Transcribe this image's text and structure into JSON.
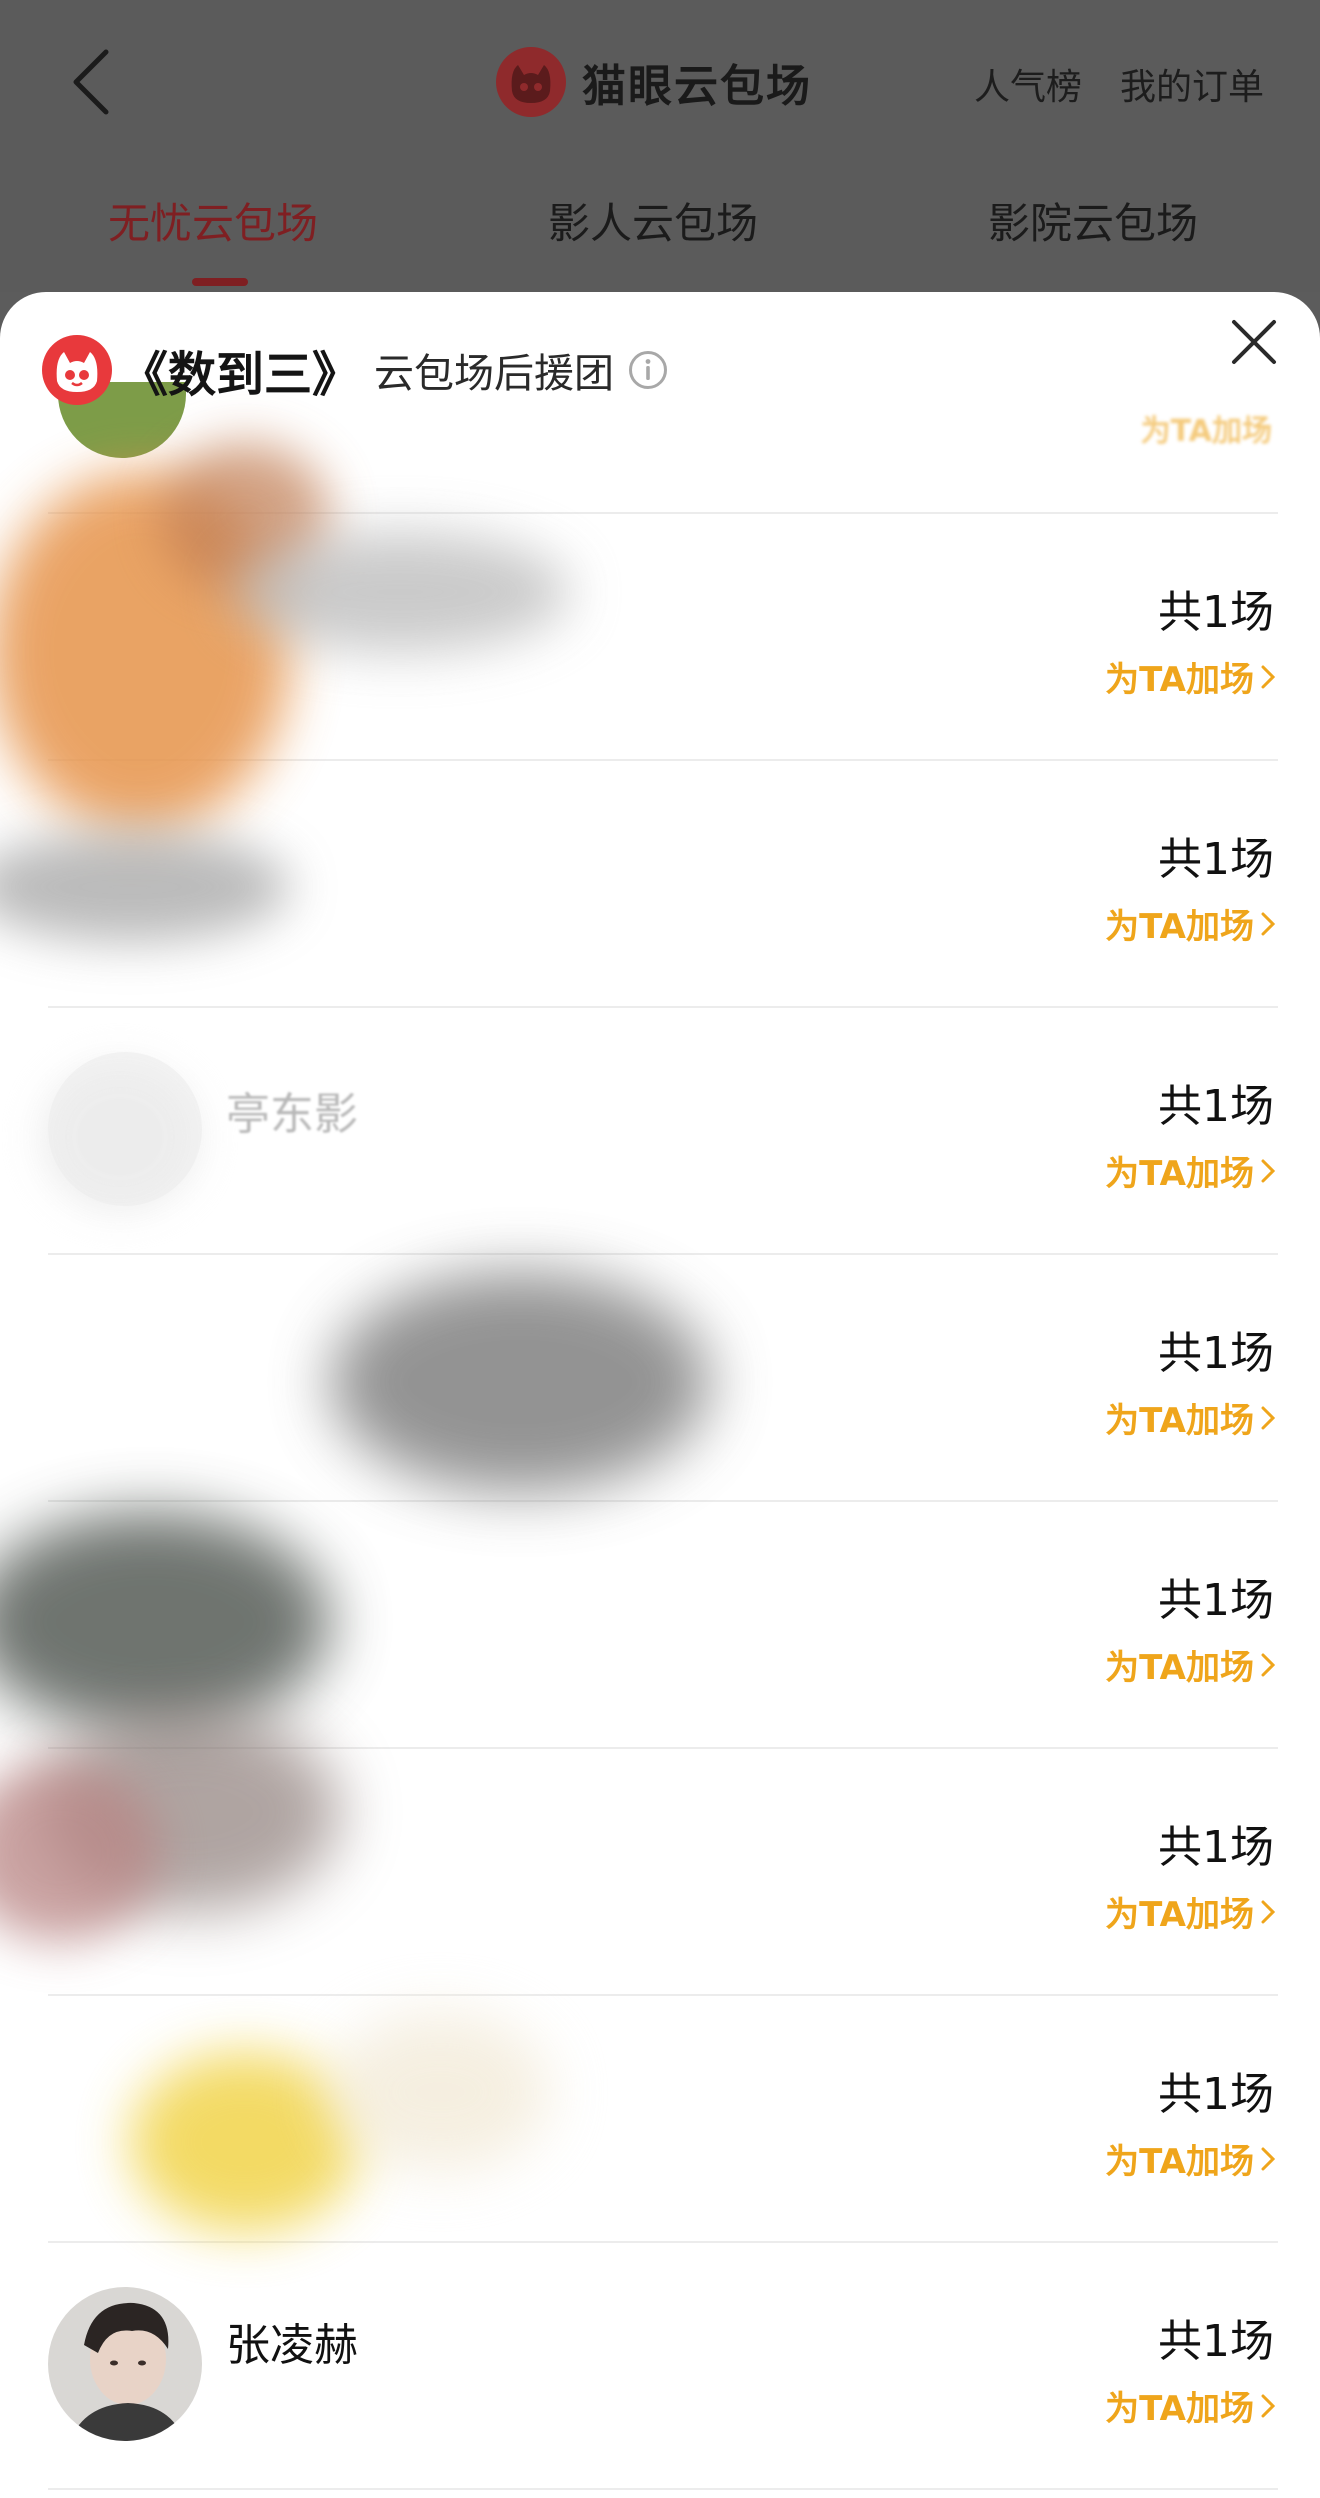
{
  "header": {
    "brand_title": "猫眼云包场",
    "link_rank": "人气榜",
    "link_orders": "我的订单",
    "colors": {
      "backdrop": "#5b5b5b",
      "accent": "#7f1f22"
    }
  },
  "tabs": [
    {
      "label": "无忧云包场",
      "active": true
    },
    {
      "label": "影人云包场",
      "active": false
    },
    {
      "label": "影院云包场",
      "active": false
    }
  ],
  "sheet": {
    "movie_title": "《数到三》",
    "subtitle": "云包场后援团",
    "info_icon": "info-circle-icon",
    "close_icon": "close-icon"
  },
  "rows": [
    {
      "name": "",
      "count": "共1场",
      "action": "为TA加场"
    },
    {
      "name": "",
      "count": "共1场",
      "action": "为TA加场"
    },
    {
      "name": "亭东影",
      "count": "共1场",
      "action": "为TA加场"
    },
    {
      "name": "",
      "count": "共1场",
      "action": "为TA加场"
    },
    {
      "name": "",
      "count": "共1场",
      "action": "为TA加场"
    },
    {
      "name": "",
      "count": "共1场",
      "action": "为TA加场"
    },
    {
      "name": "",
      "count": "共1场",
      "action": "为TA加场"
    },
    {
      "name": "张凌赫",
      "count": "共1场",
      "action": "为TA加场"
    }
  ],
  "colors": {
    "action": "#efa51b",
    "brand_red": "#e8393c"
  }
}
